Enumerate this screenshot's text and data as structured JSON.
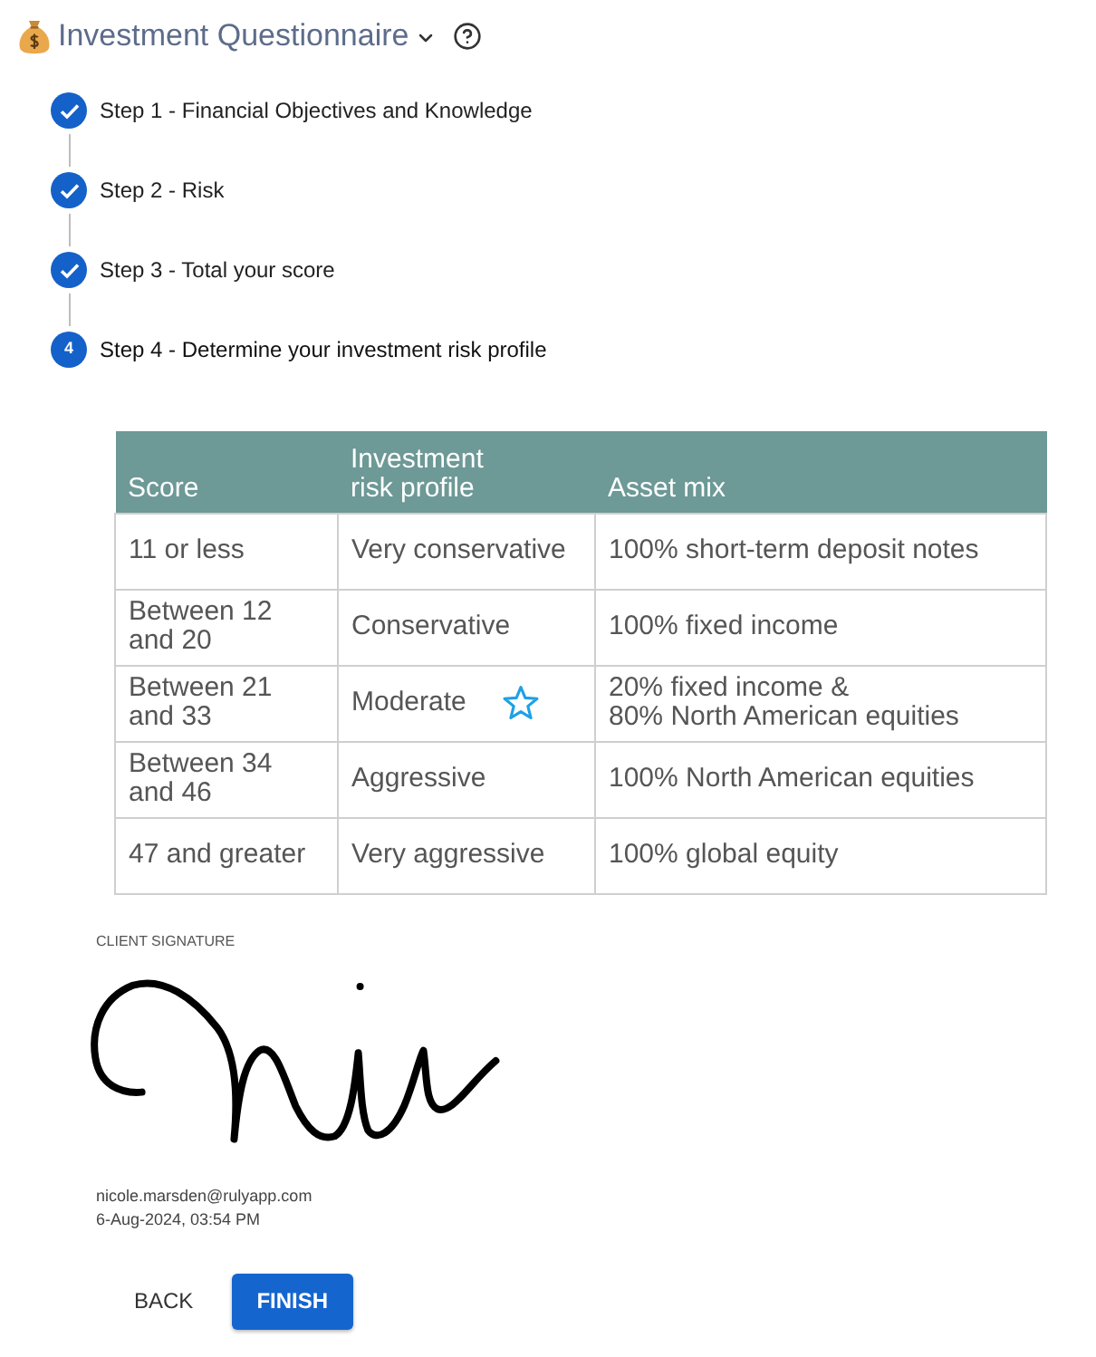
{
  "header": {
    "title": "Investment Questionnaire"
  },
  "steps": [
    {
      "label": "Step 1 - Financial Objectives and Knowledge",
      "completed": true
    },
    {
      "label": "Step 2 - Risk",
      "completed": true
    },
    {
      "label": "Step 3 - Total your score",
      "completed": true
    },
    {
      "label": "Step 4 - Determine your investment risk profile",
      "completed": false,
      "number": "4"
    }
  ],
  "table": {
    "columns": [
      "Score",
      "Investment\nrisk profile",
      "Asset mix"
    ],
    "rows": [
      {
        "cells": [
          "11 or less",
          "Very conservative",
          "100% short-term deposit notes"
        ],
        "starred": false
      },
      {
        "cells": [
          "Between 12\nand 20",
          "Conservative",
          "100% fixed income"
        ],
        "starred": false
      },
      {
        "cells": [
          "Between 21\nand 33",
          "Moderate",
          "20% fixed income &\n80% North American equities"
        ],
        "starred": true
      },
      {
        "cells": [
          "Between 34\nand 46",
          "Aggressive",
          "100% North American equities"
        ],
        "starred": false
      },
      {
        "cells": [
          "47 and greater",
          "Very aggressive",
          "100% global equity"
        ],
        "starred": false
      }
    ]
  },
  "signature": {
    "label": "CLIENT SIGNATURE",
    "email": "nicole.marsden@rulyapp.com",
    "timestamp": "6-Aug-2024, 03:54 PM"
  },
  "buttons": [
    {
      "label": "BACK",
      "kind": "text"
    },
    {
      "label": "FINISH",
      "kind": "primary"
    }
  ]
}
